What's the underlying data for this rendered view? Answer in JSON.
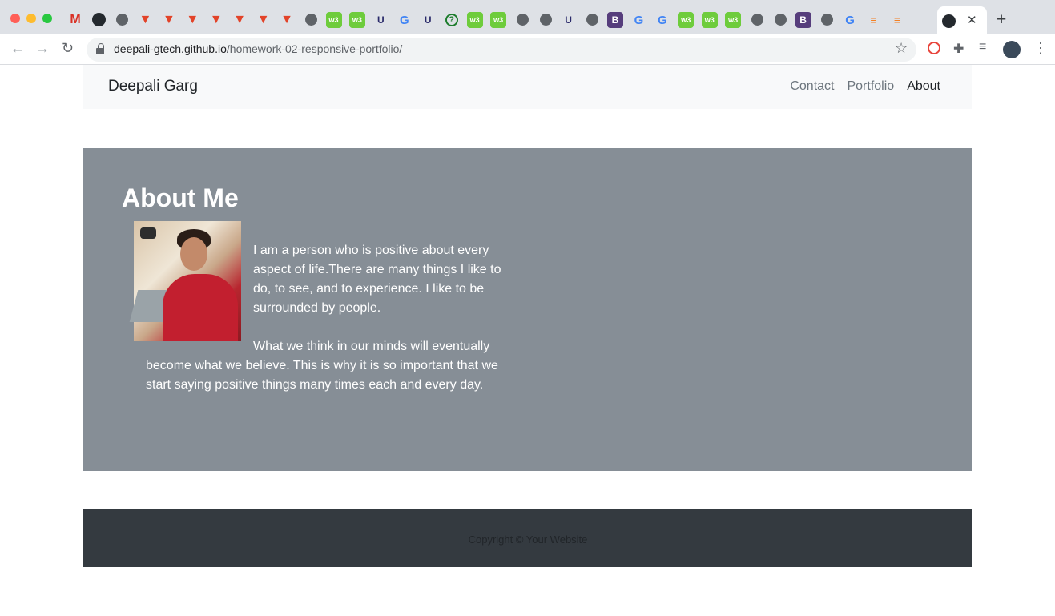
{
  "browser": {
    "url_domain": "deepali-gtech.github.io",
    "url_path": "/homework-02-responsive-portfolio/",
    "tab_close": "✕",
    "new_tab": "+",
    "tab_icons": [
      "gmail",
      "github",
      "globe",
      "gitlab",
      "gitlab",
      "gitlab",
      "gitlab",
      "gitlab",
      "gitlab",
      "gitlab",
      "globe",
      "w3",
      "w3",
      "ucd",
      "google",
      "ucd",
      "question",
      "w3",
      "w3",
      "globe",
      "globe",
      "ucd",
      "globe",
      "bootstrap",
      "google",
      "google",
      "w3",
      "w3",
      "w3",
      "globe",
      "globe",
      "bootstrap",
      "globe",
      "google",
      "stackoverflow",
      "stackoverflow"
    ]
  },
  "navbar": {
    "brand": "Deepali Garg",
    "links": [
      {
        "label": "Contact"
      },
      {
        "label": "Portfolio"
      },
      {
        "label": "About"
      }
    ]
  },
  "about": {
    "title": "About Me",
    "paragraphs": [
      "I am a person who is positive about every aspect of life.There are many things I like to do, to see, and to experience. I like to be surrounded by people.",
      "What we think in our minds will eventually become what we believe. This is why it is so important that we start saying positive things many times each and every day."
    ]
  },
  "footer": {
    "copyright": "Copyright © Your Website"
  }
}
